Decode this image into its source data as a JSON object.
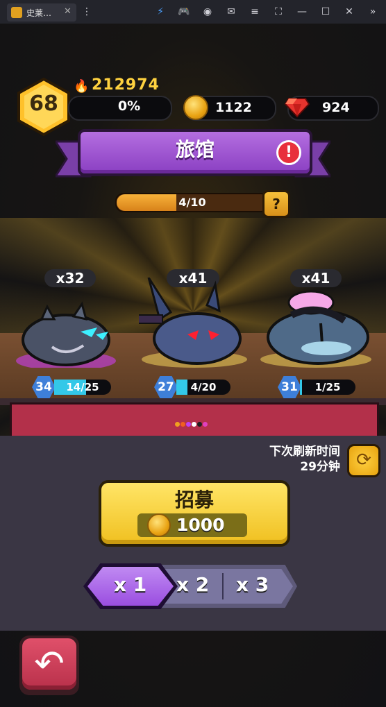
{
  "window": {
    "tab_title": "史莱…",
    "icons": [
      "app-icon",
      "close-icon",
      "menu-dots-icon",
      "bolt-icon",
      "gamepad-icon",
      "account-icon",
      "mail-icon",
      "hamburger-icon",
      "crop-icon",
      "minimize-icon",
      "maximize-icon",
      "close-window-icon",
      "expand-icon"
    ]
  },
  "header": {
    "level": "68",
    "power": "212974",
    "xp_percent": "0%",
    "coins": "1122",
    "gems": "924"
  },
  "banner": {
    "title": "旅馆"
  },
  "progress": {
    "text": "4/10",
    "fraction": 0.4,
    "help": "?"
  },
  "slimes": [
    {
      "count": "x32",
      "level": "34",
      "cards": "14/25",
      "fraction": 0.56
    },
    {
      "count": "x41",
      "level": "27",
      "cards": "4/20",
      "fraction": 0.2
    },
    {
      "count": "x41",
      "level": "31",
      "cards": "1/25",
      "fraction": 0.04
    }
  ],
  "refresh": {
    "line1": "下次刷新时间",
    "line2": "29分钟"
  },
  "recruit": {
    "label": "招募",
    "cost": "1000"
  },
  "multiplier": {
    "options": [
      "x 1",
      "x 2",
      "x 3"
    ],
    "selected": "x 1"
  },
  "colors": {
    "banner": "#a85ad8",
    "recruit": "#f7d334",
    "shelf": "#b3304a",
    "back": "#d04060"
  }
}
